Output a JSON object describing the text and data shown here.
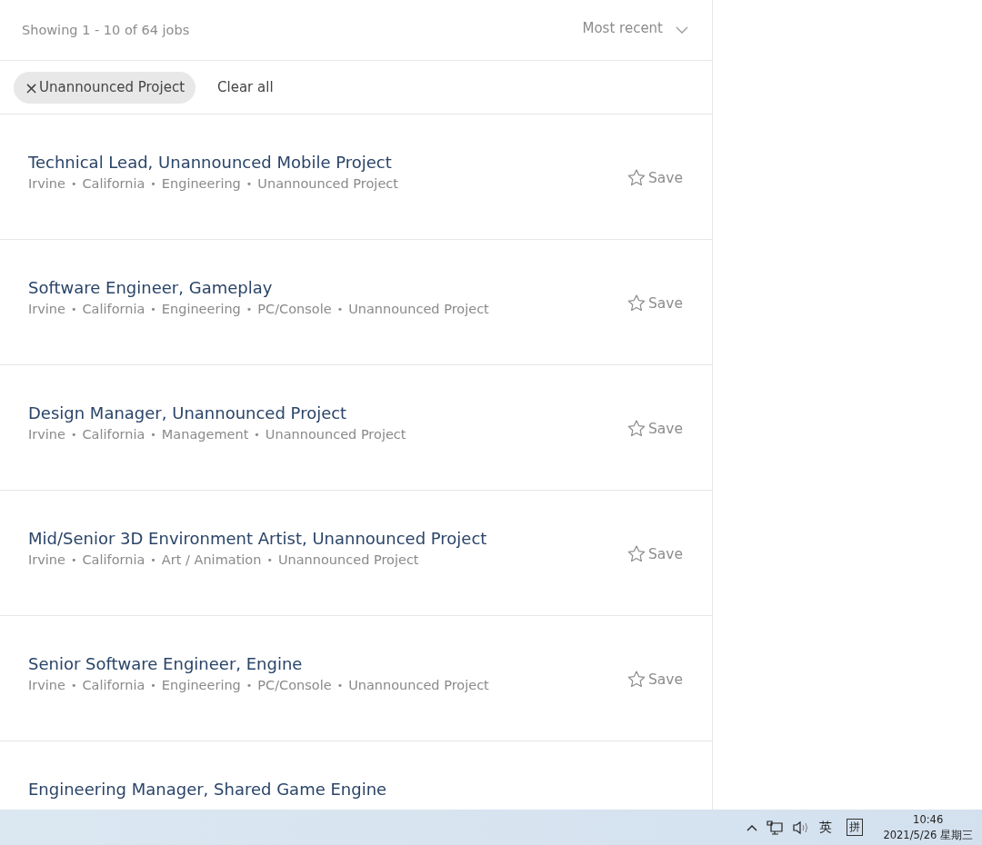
{
  "results_summary": "Showing 1 - 10 of 64 jobs",
  "sort": {
    "label": "Most recent"
  },
  "filters": [
    {
      "label": "Unannounced Project",
      "remove_icon": "×"
    }
  ],
  "clear_all": "Clear all",
  "meta_separator": "•",
  "jobs": [
    {
      "title": "Technical Lead, Unannounced Mobile Project",
      "meta": [
        "Irvine",
        "California",
        "Engineering",
        "Unannounced Project"
      ],
      "save": "Save"
    },
    {
      "title": "Software Engineer, Gameplay",
      "meta": [
        "Irvine",
        "California",
        "Engineering",
        "PC/Console",
        "Unannounced Project"
      ],
      "save": "Save"
    },
    {
      "title": "Design Manager, Unannounced Project",
      "meta": [
        "Irvine",
        "California",
        "Management",
        "Unannounced Project"
      ],
      "save": "Save"
    },
    {
      "title": "Mid/Senior 3D Environment Artist, Unannounced Project",
      "meta": [
        "Irvine",
        "California",
        "Art / Animation",
        "Unannounced Project"
      ],
      "save": "Save"
    },
    {
      "title": "Senior Software Engineer, Engine",
      "meta": [
        "Irvine",
        "California",
        "Engineering",
        "PC/Console",
        "Unannounced Project"
      ],
      "save": "Save"
    },
    {
      "title": "Engineering Manager, Shared Game Engine"
    }
  ],
  "taskbar": {
    "input_language": "英",
    "ime": "拼",
    "time": "10:46",
    "date": "2021/5/26 星期三"
  }
}
